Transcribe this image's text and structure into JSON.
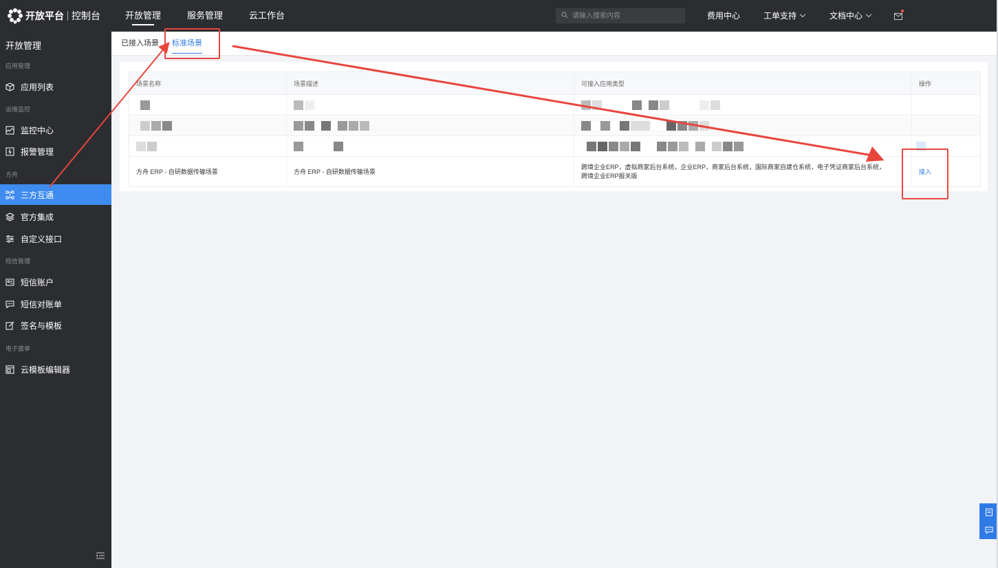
{
  "header": {
    "brand": "开放平台",
    "console": "控制台",
    "nav": [
      "开放管理",
      "服务管理",
      "云工作台"
    ],
    "search_placeholder": "请输入搜索内容",
    "right_links": {
      "fees": "费用中心",
      "tickets": "工单支持",
      "docs": "文档中心"
    }
  },
  "sidebar": {
    "title": "开放管理",
    "groups": [
      "应用管理",
      "运维监控",
      "方舟",
      "短信管理",
      "电子面单"
    ],
    "items": {
      "app_list": "应用列表",
      "monitor": "监控中心",
      "alarm": "报警管理",
      "third_party": "三方互通",
      "official": "官方集成",
      "custom_api": "自定义接口",
      "sms_account": "短信账户",
      "sms_bill": "短信对账单",
      "signature": "签名与模板",
      "cloud_editor": "云模板编辑器"
    }
  },
  "tabs": [
    "已接入场景",
    "标准场景"
  ],
  "table": {
    "headers": [
      "场景名称",
      "场景描述",
      "可接入应用类型",
      "操作"
    ],
    "row": {
      "name": "方舟 ERP - 自研数据传输场景",
      "desc": "方舟 ERP - 自研数据传输场景",
      "types_line1": "跨境企业ERP，虚拟商家后台系统，企业ERP，商家后台系统，国际商家自建仓系统，电子凭证商家后台系统，",
      "types_line2": "跨境企业ERP报关版",
      "action": "接入"
    }
  },
  "colors": {
    "accent": "#3f8cf0",
    "annotation": "#e8453c",
    "sidebar_bg": "#2b2d31"
  }
}
